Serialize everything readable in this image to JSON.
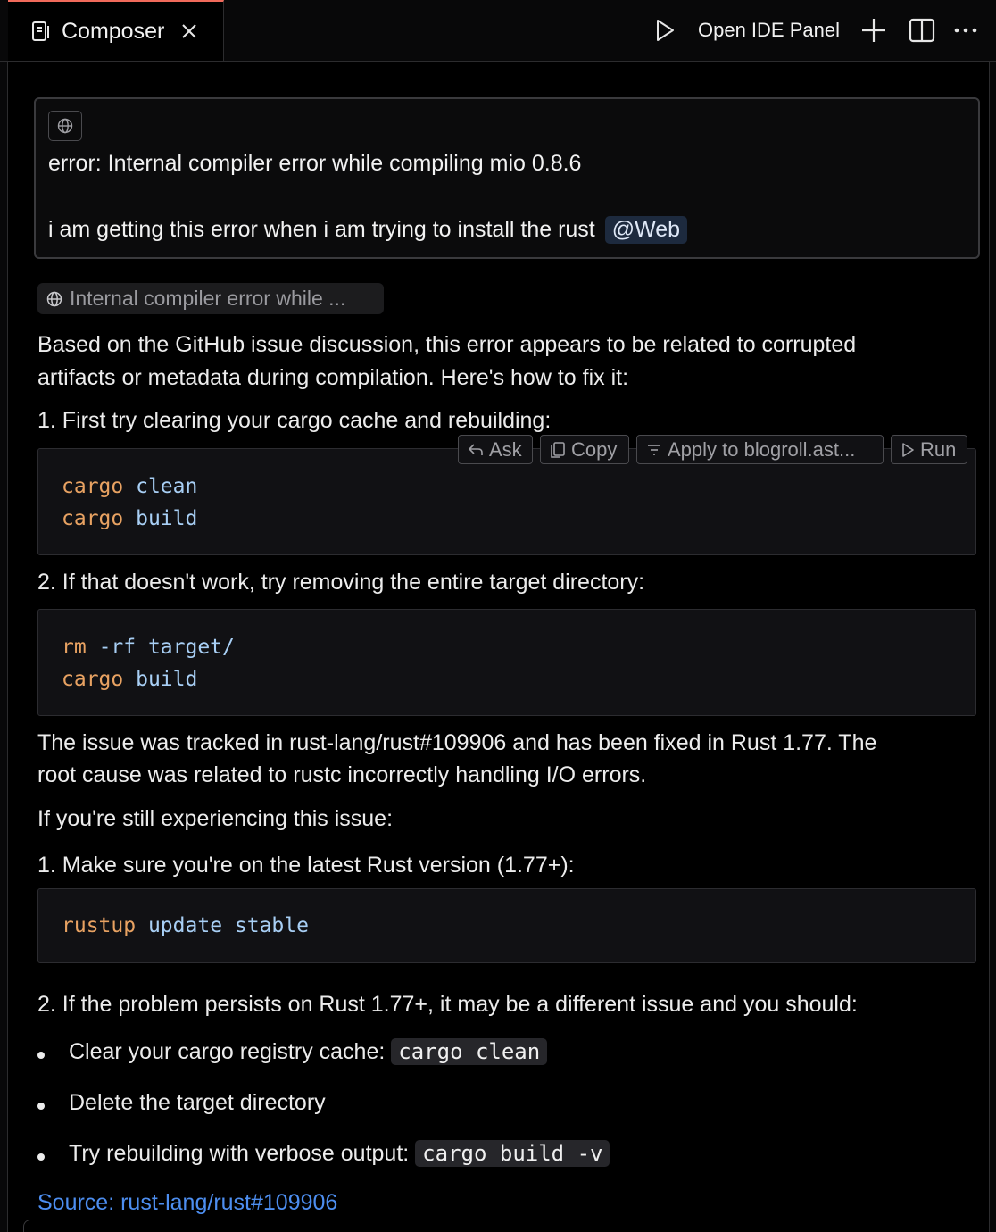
{
  "tab": {
    "label": "Composer"
  },
  "toolbar": {
    "open_ide_label": "Open IDE Panel"
  },
  "query": {
    "line1": "error: Internal compiler error while compiling mio 0.8.6",
    "line2": "i am getting this error when i am trying to install the rust",
    "mention": "@Web"
  },
  "web_result_chip": "Internal compiler error while ...",
  "answer": {
    "intro_line1": "Based on the GitHub issue discussion, this error appears to be related to corrupted",
    "intro_line2": "artifacts or metadata during compilation. Here's how to fix it:",
    "step1": "1. First try clearing your cargo cache and rebuilding:",
    "code1": [
      {
        "cmd": "cargo",
        "args": "clean"
      },
      {
        "cmd": "cargo",
        "args": "build"
      }
    ],
    "code_actions": {
      "ask": "Ask",
      "copy": "Copy",
      "apply": "Apply to blogroll.ast...",
      "run": "Run"
    },
    "step2": "2. If that doesn't work, try removing the entire target directory:",
    "code2": [
      {
        "cmd": "rm",
        "args": "-rf target/"
      },
      {
        "cmd": "cargo",
        "args": "build"
      }
    ],
    "tracked_line1": "The issue was tracked in rust-lang/rust#109906 and has been fixed in Rust 1.77. The",
    "tracked_line2": "root cause was related to rustc incorrectly handling I/O errors.",
    "still": "If you're still experiencing this issue:",
    "step3": "1. Make sure you're on the latest Rust version (1.77+):",
    "code3": [
      {
        "cmd": "rustup",
        "args": "update stable"
      }
    ],
    "step4": "2. If the problem persists on Rust 1.77+, it may be a different issue and you should:",
    "bullets": [
      {
        "text": "Clear your cargo registry cache:",
        "code": "cargo clean"
      },
      {
        "text": "Delete the target directory",
        "code": ""
      },
      {
        "text": "Try rebuilding with verbose output:",
        "code": "cargo build -v"
      }
    ],
    "source": "Source: rust-lang/rust#109906"
  },
  "colors": {
    "accent_tab": "#f06a5b",
    "code_command": "#e8a262",
    "code_argument": "#a8cff5",
    "link": "#4d8ef0"
  },
  "icons": [
    "composer-icon",
    "close-icon",
    "play-icon",
    "plus-icon",
    "split-icon",
    "more-icon",
    "globe-icon",
    "ask-icon",
    "copy-icon",
    "apply-icon",
    "run-icon"
  ]
}
